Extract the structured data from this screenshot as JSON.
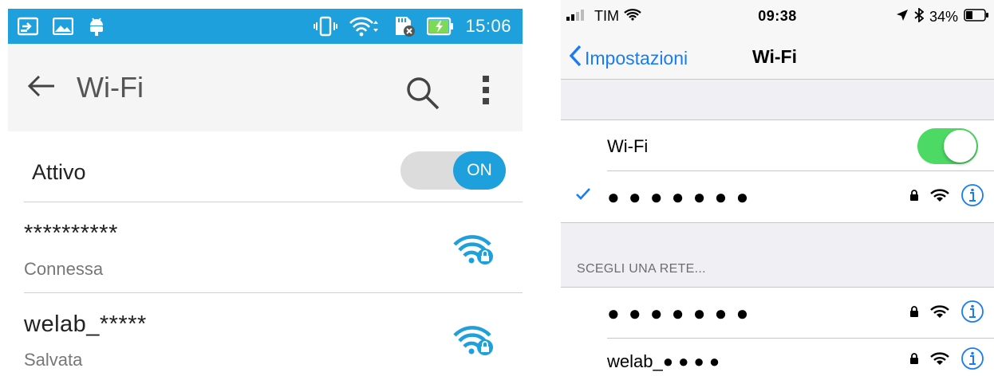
{
  "android": {
    "status_bar": {
      "time": "15:06",
      "left_icons": [
        "cast-screen-icon",
        "image-icon",
        "android-icon"
      ],
      "right_icons": [
        "vibrate-icon",
        "wifi-signal-icon",
        "sd-card-icon",
        "battery-charging-icon"
      ]
    },
    "toolbar": {
      "title": "Wi-Fi",
      "back_icon": "arrow-left-icon",
      "search_icon": "search-icon",
      "more_icon": "more-vertical-icon"
    },
    "wifi_toggle": {
      "label": "Attivo",
      "state": "ON"
    },
    "networks": [
      {
        "name": "**********",
        "status": "Connessa",
        "icon": "wifi-lock-icon"
      },
      {
        "name": "welab_*****",
        "status": "Salvata",
        "icon": "wifi-lock-icon"
      }
    ],
    "accent_color": "#1da0dc"
  },
  "ios": {
    "status_bar": {
      "carrier": "TIM",
      "time": "09:38",
      "battery": "34%"
    },
    "nav": {
      "back_label": "Impostazioni",
      "title": "Wi-Fi"
    },
    "wifi_toggle": {
      "label": "Wi-Fi",
      "on": true
    },
    "connected_network": {
      "name": "● ● ● ● ● ● ●"
    },
    "section_header": "SCEGLI UNA RETE...",
    "networks": [
      {
        "name": "● ● ● ● ● ● ●"
      },
      {
        "name": "welab_● ● ● ●"
      }
    ],
    "tint_color": "#1a7cf5",
    "switch_color": "#4cd964"
  }
}
